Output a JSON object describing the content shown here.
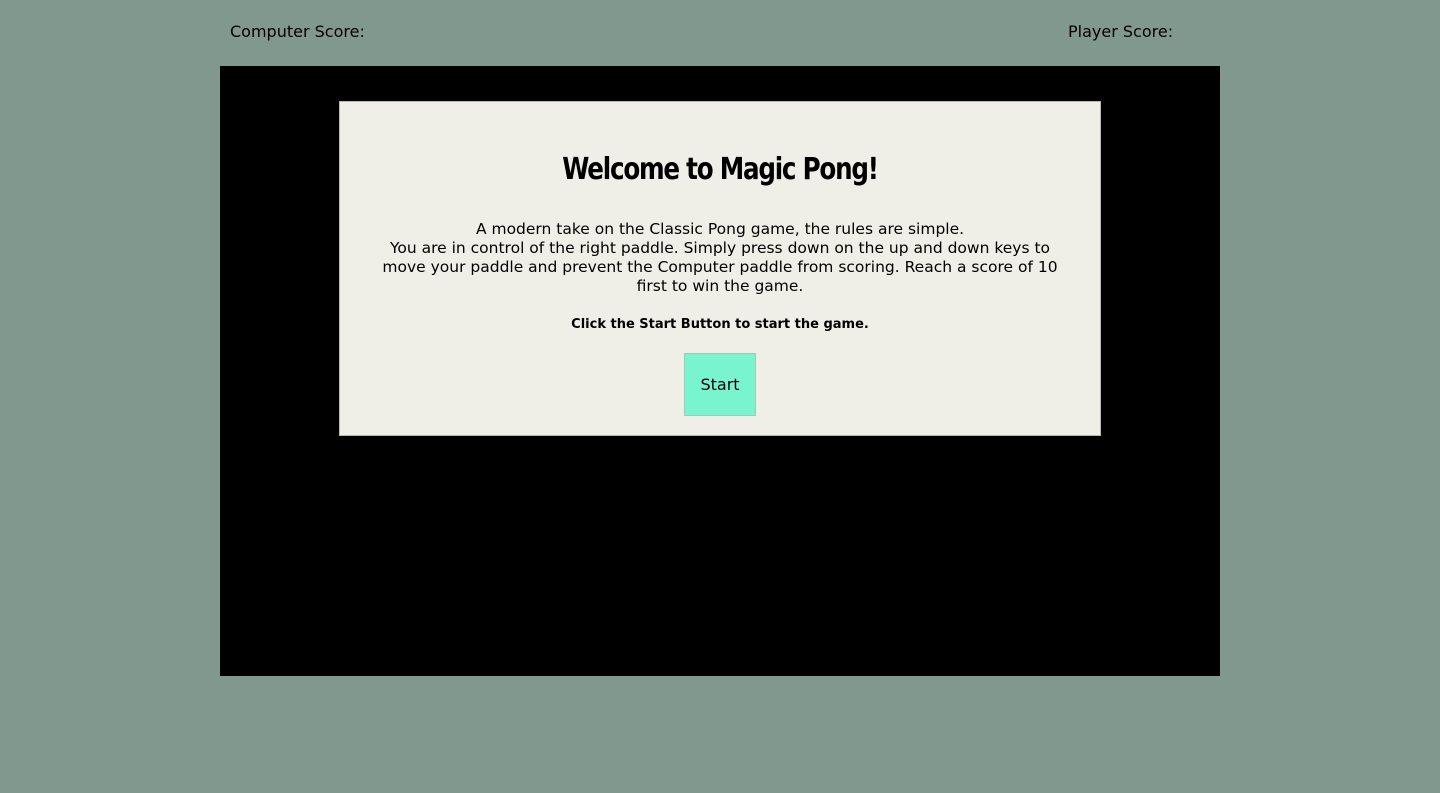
{
  "scores": {
    "computer_label": "Computer Score:",
    "computer_value": "",
    "player_label": "Player Score:",
    "player_value": ""
  },
  "welcome": {
    "title": "Welcome to Magic Pong!",
    "desc_line1": "A modern take on the Classic Pong game, the rules are simple.",
    "desc_line2": "You are in control of the right paddle. Simply press down on the up and down keys to move your paddle and prevent the Computer paddle from scoring. Reach a score of 10 first to win the game.",
    "instruction": "Click the Start Button to start the game.",
    "start_label": "Start"
  },
  "colors": {
    "page_background": "#81988f",
    "game_background": "#000000",
    "panel_background": "#efefe7",
    "start_button": "#78f4cf"
  }
}
